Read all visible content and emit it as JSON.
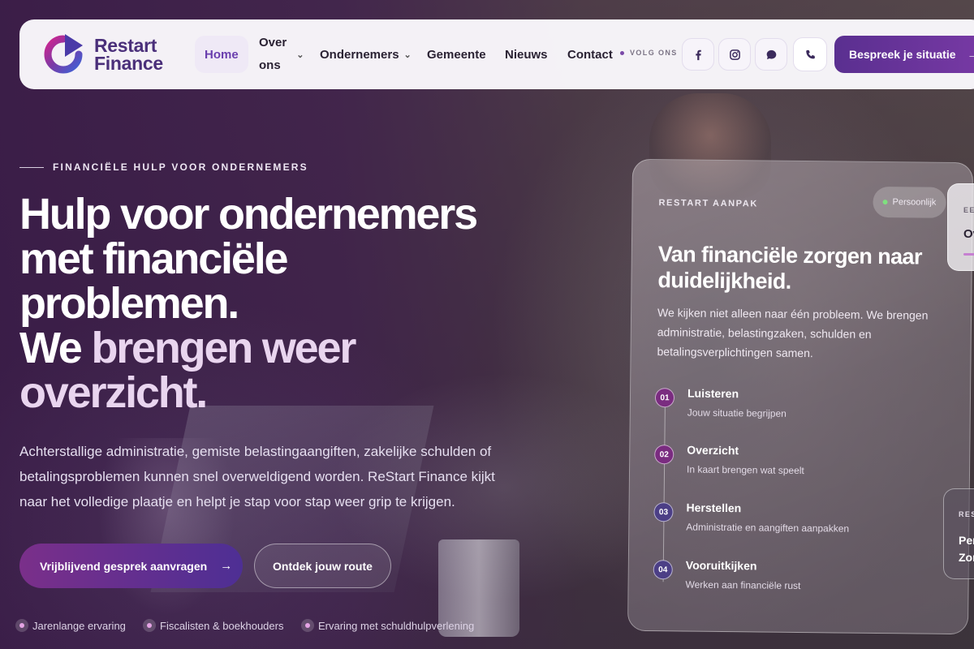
{
  "nav": {
    "logo_line1": "Restart",
    "logo_line2": "Finance",
    "links": [
      {
        "label": "Home",
        "active": true
      },
      {
        "label_line1": "Over",
        "label_line2": "ons",
        "has_dropdown": true
      },
      {
        "label": "Ondernemers",
        "has_dropdown": true
      },
      {
        "label": "Gemeente"
      },
      {
        "label": "Nieuws"
      },
      {
        "label": "Contact"
      }
    ],
    "follow_label": "VOLG ONS",
    "social_icons": [
      "facebook-icon",
      "instagram-icon",
      "chat-icon",
      "phone-icon"
    ],
    "cta_label": "Bespreek je situatie",
    "cta_arrow": "→"
  },
  "hero": {
    "eyebrow": "FINANCIËLE HULP VOOR ONDERNEMERS",
    "title_lines": [
      "Hulp voor ondernemers",
      "met financiële",
      "problemen."
    ],
    "title_line4_plain": "We ",
    "title_line4_accent": "brengen weer",
    "title_line5_accent": "overzicht.",
    "subtitle": "Achterstallige administratie, gemiste belastingaangiften, zakelijke schulden of betalingsproblemen kunnen snel overweldigend worden. ReStart Finance kijkt naar het volledige plaatje en helpt je stap voor stap weer grip te krijgen.",
    "primary_button": "Vrijblijvend gesprek aanvragen",
    "primary_arrow": "→",
    "secondary_button": "Ontdek jouw route",
    "trust": [
      "Jarenlange ervaring",
      "Fiscalisten & boekhouders",
      "Ervaring met schuldhulpverlening"
    ]
  },
  "card": {
    "eyebrow": "RESTART AANPAK",
    "pill": "Persoonlijk",
    "title": "Van financiële zorgen naar duidelijkheid.",
    "text": "We kijken niet alleen naar één probleem. We brengen administratie, belastingzaken, schulden en betalingsverplichtingen samen.",
    "steps": [
      {
        "num": "01",
        "title": "Luisteren",
        "desc": "Jouw situatie begrijpen"
      },
      {
        "num": "02",
        "title": "Overzicht",
        "desc": "In kaart brengen wat speelt"
      },
      {
        "num": "03",
        "title": "Herstellen",
        "desc": "Administratie en aangiften aanpakken"
      },
      {
        "num": "04",
        "title": "Vooruitkijken",
        "desc": "Werken aan financiële rust"
      }
    ]
  },
  "side_card_top": {
    "eyebrow": "EE",
    "title": "Ov"
  },
  "side_card_bottom": {
    "eyebrow": "RES",
    "line1": "Per",
    "line2": "Zor"
  },
  "colors": {
    "brand_purple": "#5a2f90",
    "accent_magenta": "#7a2f8a",
    "nav_active_bg": "#efe9f6",
    "nav_active_text": "#6a3fae"
  }
}
